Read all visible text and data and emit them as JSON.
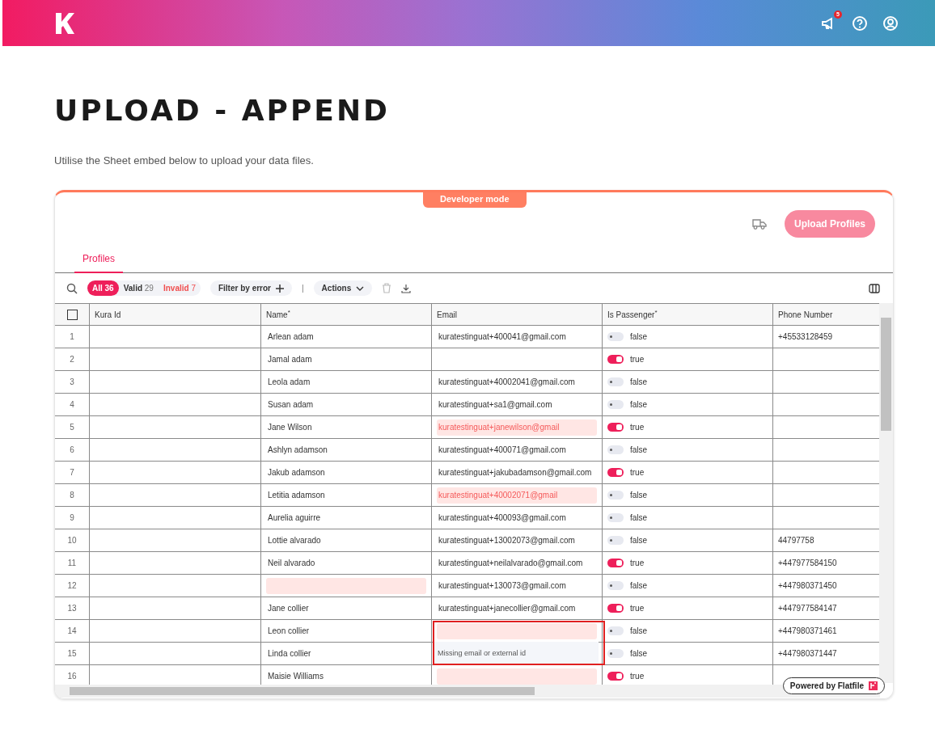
{
  "header": {
    "notification_count": "5"
  },
  "page": {
    "title": "UPLOAD - APPEND",
    "subtitle": "Utilise the Sheet embed below to upload your data files."
  },
  "sheet": {
    "developer_badge": "Developer mode",
    "upload_button": "Upload Profiles",
    "tabs": [
      {
        "label": "Profiles",
        "selected": true
      }
    ],
    "filters": [
      {
        "label": "All",
        "count": "36",
        "kind": "all",
        "selected": true
      },
      {
        "label": "Valid",
        "count": "29",
        "kind": "valid",
        "selected": false
      },
      {
        "label": "Invalid",
        "count": "7",
        "kind": "invalid",
        "selected": false
      }
    ],
    "filter_by_error": "Filter by error",
    "separator": "|",
    "actions": "Actions",
    "select_all": {
      "checked": false
    },
    "columns": [
      {
        "label": "Kura Id"
      },
      {
        "label": "Name$^{*}$"
      },
      {
        "label": "Email"
      },
      {
        "label": "Is Passenger$^{*}$"
      },
      {
        "label": "Phone Number"
      }
    ],
    "rows": [
      {
        "num": "1",
        "name": {
          "value": "Arlean adam",
          "error": false
        },
        "email": {
          "value": "kuratestinguat+400041@gmail.com",
          "error": false
        },
        "passenger": {
          "value": "false",
          "on": false
        },
        "phone": "+45533128459"
      },
      {
        "num": "2",
        "name": {
          "value": "Jamal adam",
          "error": false
        },
        "email": {},
        "passenger": {
          "value": "true",
          "on": true
        },
        "phone": ""
      },
      {
        "num": "3",
        "name": {
          "value": "Leola adam",
          "error": false
        },
        "email": {
          "value": "kuratestinguat+40002041@gmail.com",
          "error": false
        },
        "passenger": {
          "value": "false",
          "on": false
        },
        "phone": ""
      },
      {
        "num": "4",
        "name": {
          "value": "Susan adam",
          "error": false
        },
        "email": {
          "value": "kuratestinguat+sa1@gmail.com",
          "error": false
        },
        "passenger": {
          "value": "false",
          "on": false
        },
        "phone": ""
      },
      {
        "num": "5",
        "name": {
          "value": "Jane Wilson",
          "error": false
        },
        "email": {
          "value": "kuratestinguat+janewilson@gmail",
          "error": true
        },
        "passenger": {
          "value": "true",
          "on": true
        },
        "phone": ""
      },
      {
        "num": "6",
        "name": {
          "value": "Ashlyn adamson",
          "error": false
        },
        "email": {
          "value": "kuratestinguat+400071@gmail.com",
          "error": false
        },
        "passenger": {
          "value": "false",
          "on": false
        },
        "phone": ""
      },
      {
        "num": "7",
        "name": {
          "value": "Jakub adamson",
          "error": false
        },
        "email": {
          "value": "kuratestinguat+jakubadamson@gmail.com",
          "error": false
        },
        "passenger": {
          "value": "true",
          "on": true
        },
        "phone": ""
      },
      {
        "num": "8",
        "name": {
          "value": "Letitia adamson",
          "error": false
        },
        "email": {
          "value": "kuratestinguat+40002071@gmail",
          "error": true
        },
        "passenger": {
          "value": "false",
          "on": false
        },
        "phone": ""
      },
      {
        "num": "9",
        "name": {
          "value": "Aurelia aguirre",
          "error": false
        },
        "email": {
          "value": "kuratestinguat+400093@gmail.com",
          "error": false
        },
        "passenger": {
          "value": "false",
          "on": false
        },
        "phone": ""
      },
      {
        "num": "10",
        "name": {
          "value": "Lottie alvarado",
          "error": false
        },
        "email": {
          "value": "kuratestinguat+13002073@gmail.com",
          "error": false
        },
        "passenger": {
          "value": "false",
          "on": false
        },
        "phone": "44797758"
      },
      {
        "num": "11",
        "name": {
          "value": "Neil alvarado",
          "error": false
        },
        "email": {
          "value": "kuratestinguat+neilalvarado@gmail.com",
          "error": false
        },
        "passenger": {
          "value": "true",
          "on": true
        },
        "phone": "+447977584150"
      },
      {
        "num": "12",
        "name": {
          "error": true
        },
        "email": {
          "value": "kuratestinguat+130073@gmail.com",
          "error": false
        },
        "passenger": {
          "value": "false",
          "on": false
        },
        "phone": "+447980371450"
      },
      {
        "num": "13",
        "name": {
          "value": "Jane collier",
          "error": false
        },
        "email": {
          "value": "kuratestinguat+janecollier@gmail.com",
          "error": false
        },
        "passenger": {
          "value": "true",
          "on": true
        },
        "phone": "+447977584147"
      },
      {
        "num": "14",
        "name": {
          "value": "Leon collier",
          "error": false
        },
        "email": {
          "error": true,
          "tooltip": "Missing email or external id"
        },
        "passenger": {
          "value": "false",
          "on": false
        },
        "phone": "+447980371461"
      },
      {
        "num": "15",
        "name": {
          "value": "Linda collier",
          "error": false
        },
        "email": {},
        "passenger": {
          "value": "false",
          "on": false
        },
        "phone": "+447980371447"
      },
      {
        "num": "16",
        "name": {
          "value": "Maisie Williams",
          "error": false
        },
        "email": {
          "error": true
        },
        "passenger": {
          "value": "true",
          "on": true
        },
        "phone": ""
      }
    ],
    "powered_by": "Powered by Flatfile"
  }
}
